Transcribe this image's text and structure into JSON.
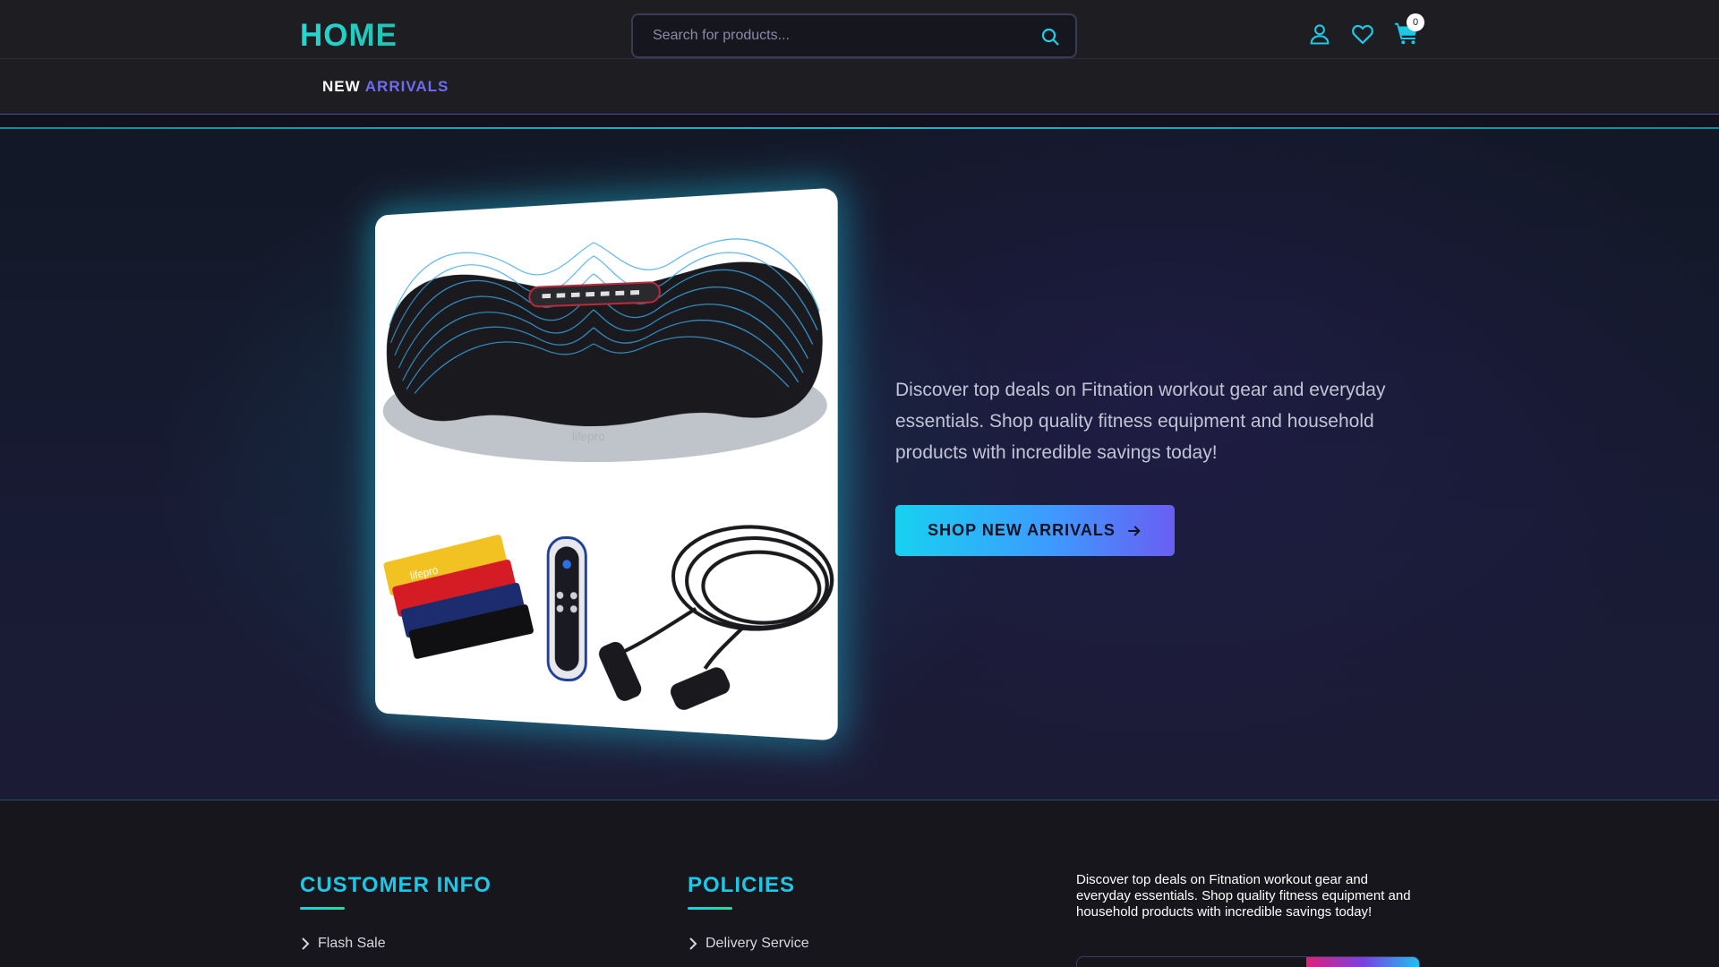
{
  "header": {
    "logo": "HOME",
    "search_placeholder": "Search for products...",
    "cart_count": "0",
    "icons": [
      "user-icon",
      "heart-icon",
      "cart-icon",
      "search-icon"
    ]
  },
  "nav": {
    "items": [
      {
        "word1": "NEW",
        "word2": "ARRIVALS"
      }
    ]
  },
  "hero": {
    "description": "Discover top deals on Fitnation workout gear and everyday essentials. Shop quality fitness equipment and household products with incredible savings today!",
    "cta_label": "SHOP NEW ARRIVALS",
    "product_logo": "lifepro"
  },
  "footer": {
    "customer_info": {
      "heading": "CUSTOMER INFO",
      "links": [
        "Flash Sale"
      ]
    },
    "policies": {
      "heading": "POLICIES",
      "links": [
        "Delivery Service"
      ]
    },
    "description": "Discover top deals on Fitnation workout gear and everyday essentials. Shop quality fitness equipment and household products with incredible savings today!"
  },
  "colors": {
    "accent_cyan": "#1fc7e6",
    "accent_purple": "#6f6cf2",
    "teal_logo": "#25d8d0",
    "background": "#12121e"
  }
}
